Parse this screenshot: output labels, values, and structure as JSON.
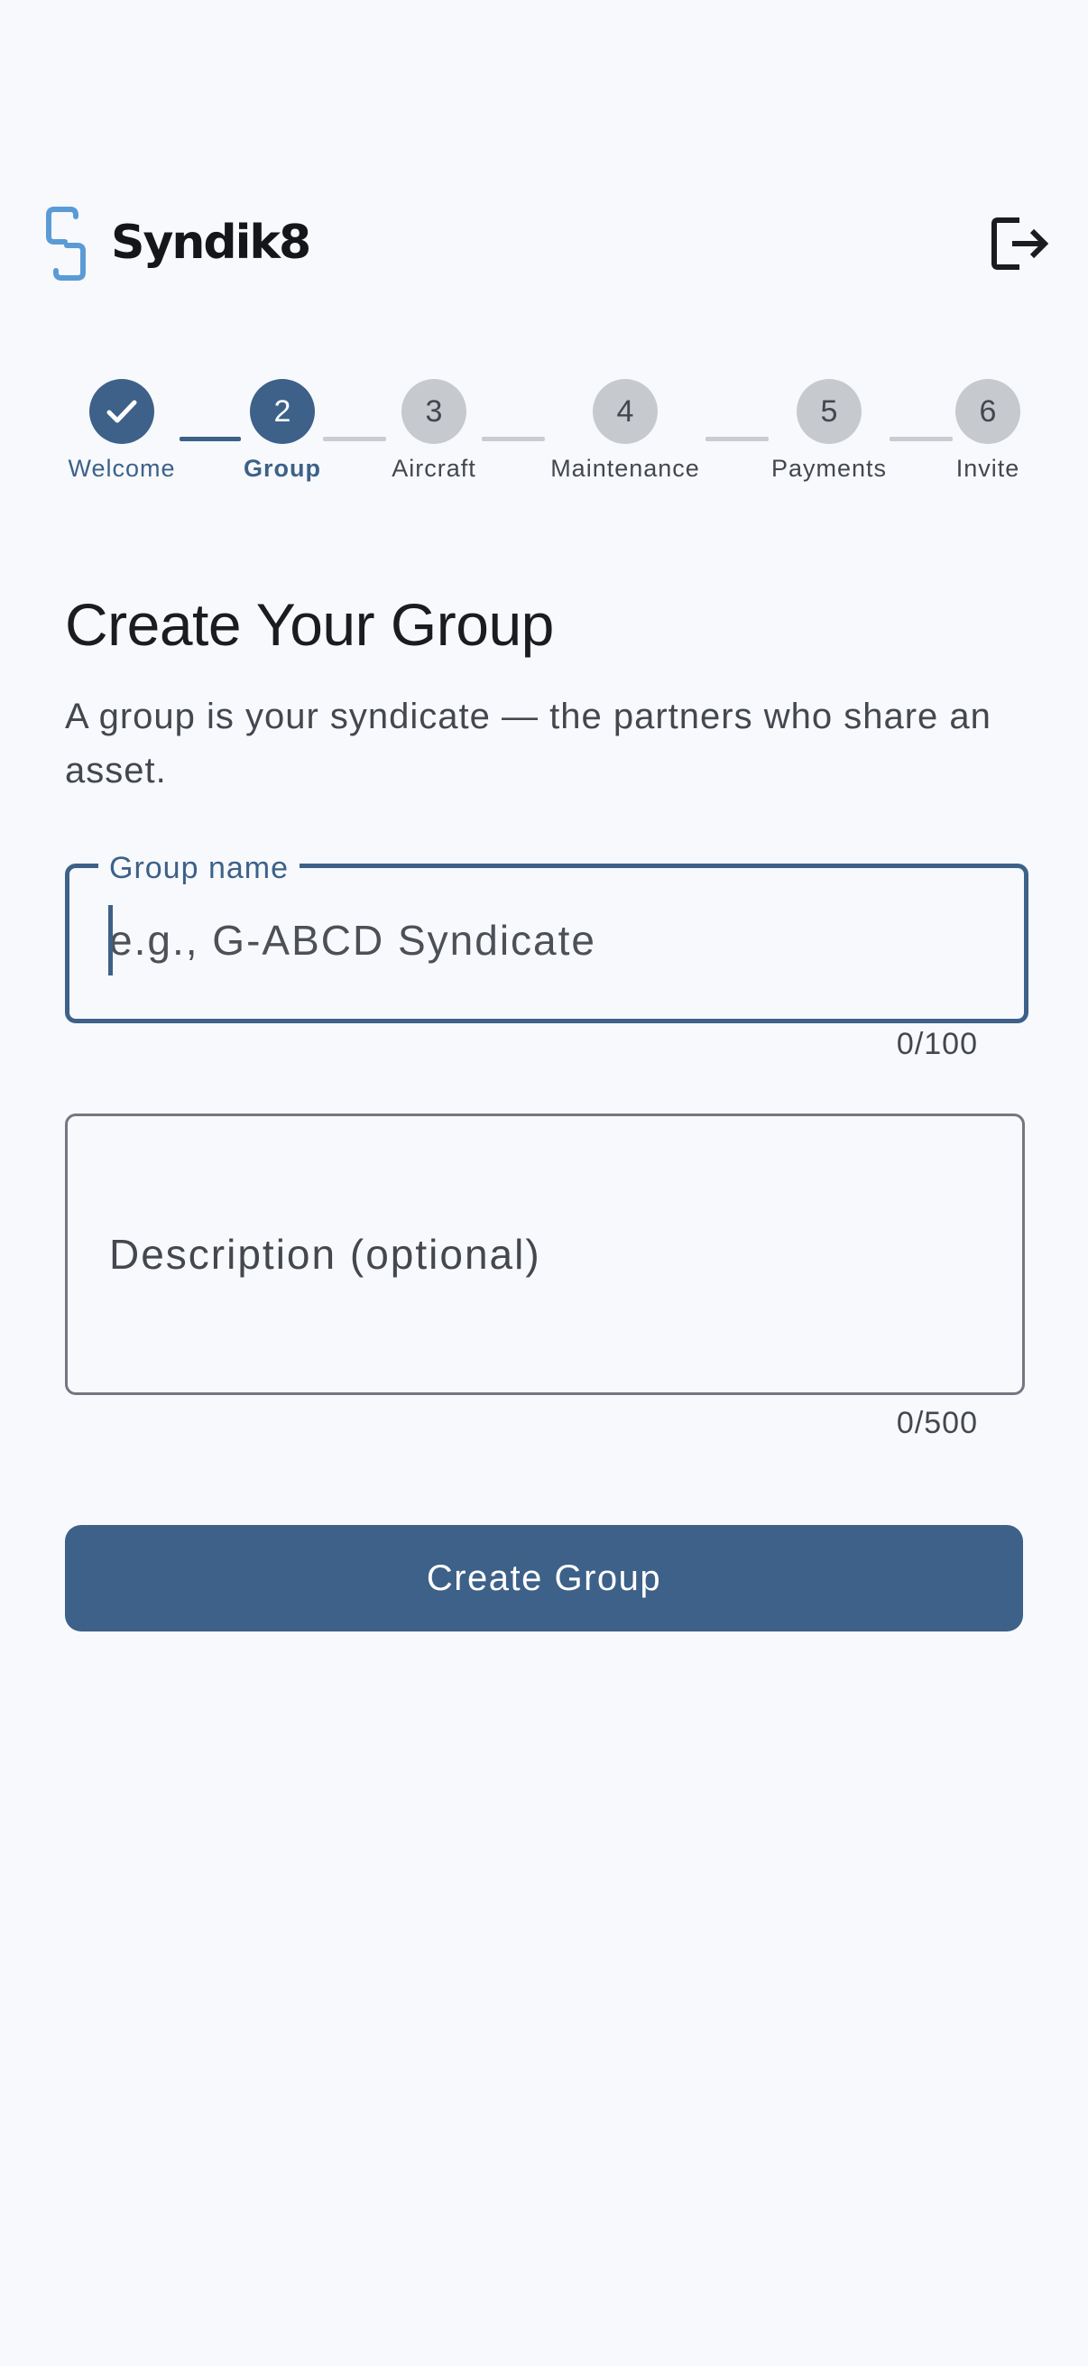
{
  "app": {
    "name": "Syndik8",
    "logo_icon": "chain-link-s-logo-icon",
    "logout_icon": "logout-icon"
  },
  "stepper": {
    "steps": [
      {
        "number": "1",
        "label": "Welcome",
        "state": "completed",
        "icon": "check-icon"
      },
      {
        "number": "2",
        "label": "Group",
        "state": "active"
      },
      {
        "number": "3",
        "label": "Aircraft",
        "state": "upcoming"
      },
      {
        "number": "4",
        "label": "Maintenance",
        "state": "upcoming"
      },
      {
        "number": "5",
        "label": "Payments",
        "state": "upcoming"
      },
      {
        "number": "6",
        "label": "Invite",
        "state": "upcoming"
      }
    ]
  },
  "page": {
    "title": "Create Your Group",
    "subtitle": "A group is your syndicate — the partners who share an asset."
  },
  "form": {
    "group_name": {
      "label": "Group name",
      "value": "",
      "placeholder": "e.g., G-ABCD Syndicate",
      "counter": "0/100",
      "focused": true
    },
    "description": {
      "label": "Description (optional)",
      "value": "",
      "counter": "0/500"
    },
    "submit_label": "Create Group"
  },
  "colors": {
    "primary": "#3d6188",
    "background": "#f7f9fd",
    "inactive_step": "#c6c9ce",
    "logo_blue": "#5b9bd5"
  }
}
